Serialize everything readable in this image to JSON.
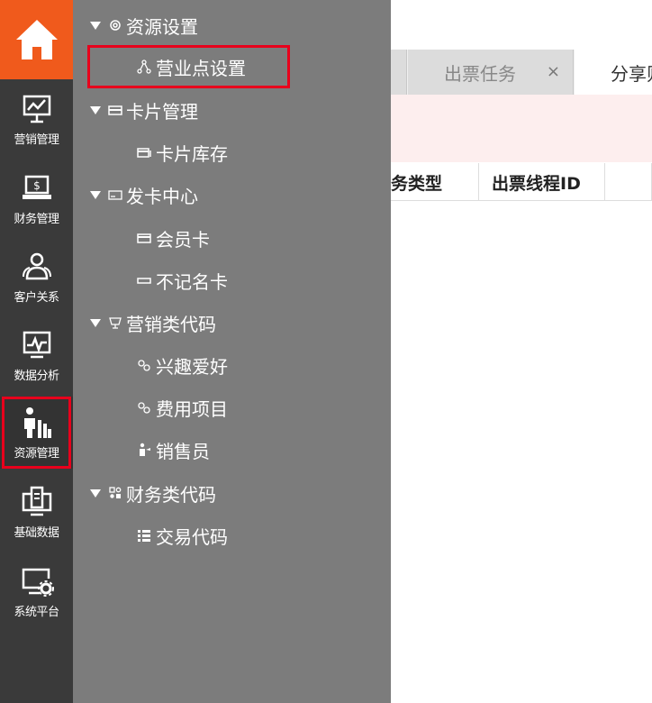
{
  "rail": {
    "items": [
      {
        "label": "营销管理",
        "icon": "chart-board-icon"
      },
      {
        "label": "财务管理",
        "icon": "laptop-dollar-icon"
      },
      {
        "label": "客户关系",
        "icon": "users-icon"
      },
      {
        "label": "数据分析",
        "icon": "line-chart-icon"
      },
      {
        "label": "资源管理",
        "icon": "resource-people-icon"
      },
      {
        "label": "基础数据",
        "icon": "clipboard-monitor-icon"
      },
      {
        "label": "系统平台",
        "icon": "monitor-gear-icon"
      }
    ],
    "active_index": 4,
    "home_icon": "home-icon",
    "accent": "#f05a1c",
    "highlight": "#e8001c"
  },
  "tree": {
    "groups": [
      {
        "label": "资源设置",
        "icon": "gear-icon",
        "children": [
          {
            "label": "营业点设置",
            "icon": "network-icon"
          }
        ]
      },
      {
        "label": "卡片管理",
        "icon": "card-icon",
        "children": [
          {
            "label": "卡片库存",
            "icon": "card-stack-icon"
          }
        ]
      },
      {
        "label": "发卡中心",
        "icon": "card-outline-icon",
        "children": [
          {
            "label": "会员卡",
            "icon": "member-card-icon"
          },
          {
            "label": "不记名卡",
            "icon": "blank-card-icon"
          }
        ]
      },
      {
        "label": "营销类代码",
        "icon": "cup-icon",
        "children": [
          {
            "label": "兴趣爱好",
            "icon": "link-icon"
          },
          {
            "label": "费用项目",
            "icon": "link-icon"
          },
          {
            "label": "销售员",
            "icon": "person-icon"
          }
        ]
      },
      {
        "label": "财务类代码",
        "icon": "code-icon",
        "children": [
          {
            "label": "交易代码",
            "icon": "list-icon"
          }
        ]
      }
    ]
  },
  "main": {
    "tabs": [
      {
        "label": "出票任务",
        "close": "×"
      },
      {
        "label": "分享则"
      }
    ],
    "columns": [
      "业务类型",
      "出票线程ID"
    ],
    "column_partial": "务类型"
  }
}
